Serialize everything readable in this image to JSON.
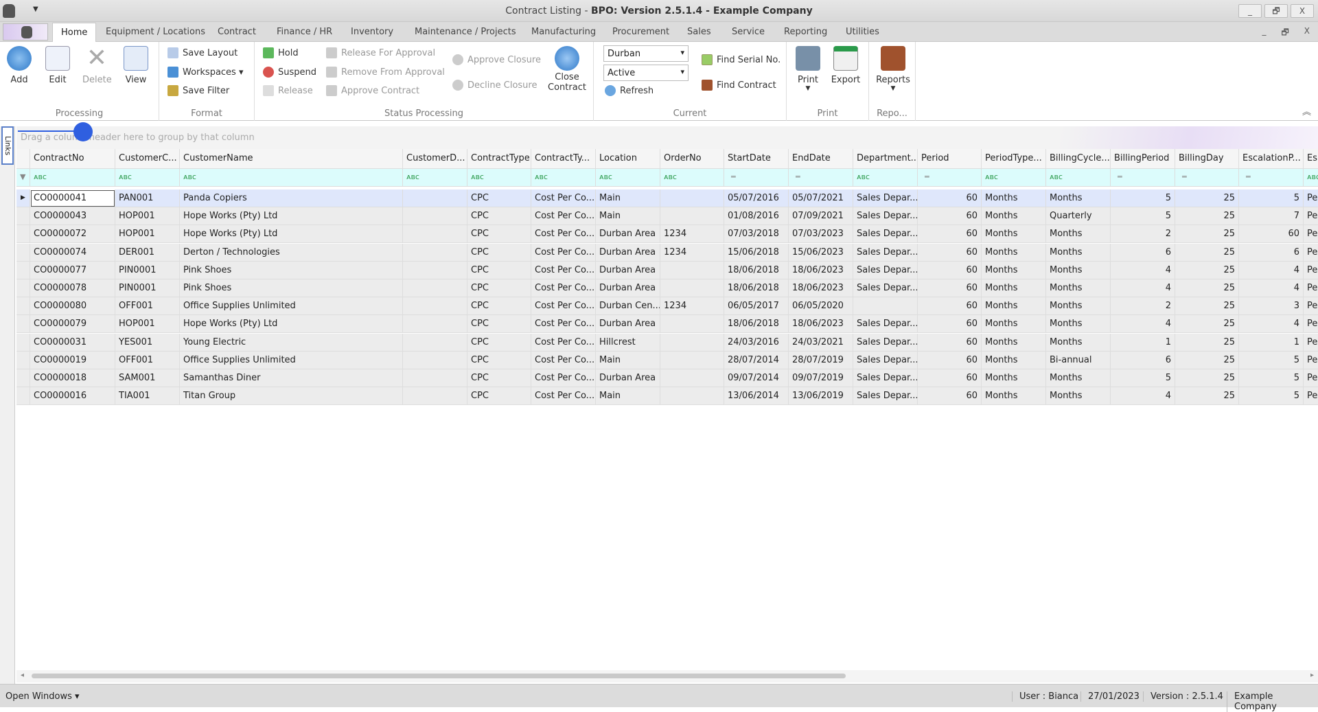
{
  "window": {
    "title_prefix": "Contract Listing - ",
    "title_bold": "BPO: Version 2.5.1.4 - Example Company",
    "min": "_",
    "restore": "🗗",
    "close": "X"
  },
  "tabs": [
    "Home",
    "Equipment / Locations",
    "Contract",
    "Finance / HR",
    "Inventory",
    "Maintenance / Projects",
    "Manufacturing",
    "Procurement",
    "Sales",
    "Service",
    "Reporting",
    "Utilities"
  ],
  "ribbon": {
    "processing": {
      "label": "Processing",
      "add": "Add",
      "edit": "Edit",
      "delete": "Delete",
      "view": "View"
    },
    "format": {
      "label": "Format",
      "save_layout": "Save Layout",
      "workspaces": "Workspaces ▾",
      "save_filter": "Save Filter"
    },
    "status": {
      "label": "Status Processing",
      "hold": "Hold",
      "suspend": "Suspend",
      "release": "Release",
      "release_for_approval": "Release For Approval",
      "remove_from_approval": "Remove From Approval",
      "approve_contract": "Approve Contract",
      "approve_closure": "Approve Closure",
      "decline_closure": "Decline Closure",
      "close_contract_1": "Close",
      "close_contract_2": "Contract"
    },
    "current": {
      "label": "Current",
      "branch": "Durban",
      "state": "Active",
      "refresh": "Refresh",
      "find_serial": "Find Serial No.",
      "find_contract": "Find Contract"
    },
    "print": {
      "label": "Print",
      "print": "Print",
      "export": "Export"
    },
    "reports": {
      "label": "Repo...",
      "reports": "Reports"
    }
  },
  "links_label": "Links",
  "group_hint": "Drag a column header here to group by that column",
  "columns": [
    "ContractNo",
    "CustomerC...",
    "CustomerName",
    "CustomerD...",
    "ContractType",
    "ContractTy...",
    "Location",
    "OrderNo",
    "StartDate",
    "EndDate",
    "Department...",
    "Period",
    "PeriodType...",
    "BillingCycle...",
    "BillingPeriod",
    "BillingDay",
    "EscalationP...",
    "Es"
  ],
  "filter_icons": [
    "abc",
    "abc",
    "abc",
    "abc",
    "abc",
    "abc",
    "abc",
    "abc",
    "=",
    "=",
    "abc",
    "=",
    "abc",
    "abc",
    "=",
    "=",
    "=",
    "abc"
  ],
  "rows": [
    [
      "CO0000041",
      "PAN001",
      "Panda Copiers",
      "",
      "CPC",
      "Cost Per Co...",
      "Main",
      "",
      "05/07/2016",
      "05/07/2021",
      "Sales Depar...",
      "60",
      "Months",
      "Months",
      "5",
      "25",
      "5",
      "Pe"
    ],
    [
      "CO0000043",
      "HOP001",
      "Hope Works (Pty) Ltd",
      "",
      "CPC",
      "Cost Per Co...",
      "Main",
      "",
      "01/08/2016",
      "07/09/2021",
      "Sales Depar...",
      "60",
      "Months",
      "Quarterly",
      "5",
      "25",
      "7",
      "Pe"
    ],
    [
      "CO0000072",
      "HOP001",
      "Hope Works (Pty) Ltd",
      "",
      "CPC",
      "Cost Per Co...",
      "Durban Area",
      "1234",
      "07/03/2018",
      "07/03/2023",
      "Sales Depar...",
      "60",
      "Months",
      "Months",
      "2",
      "25",
      "60",
      "Pe"
    ],
    [
      "CO0000074",
      "DER001",
      "Derton / Technologies",
      "",
      "CPC",
      "Cost Per Co...",
      "Durban Area",
      "1234",
      "15/06/2018",
      "15/06/2023",
      "Sales Depar...",
      "60",
      "Months",
      "Months",
      "6",
      "25",
      "6",
      "Pe"
    ],
    [
      "CO0000077",
      "PIN0001",
      "Pink Shoes",
      "",
      "CPC",
      "Cost Per Co...",
      "Durban Area",
      "",
      "18/06/2018",
      "18/06/2023",
      "Sales Depar...",
      "60",
      "Months",
      "Months",
      "4",
      "25",
      "4",
      "Pe"
    ],
    [
      "CO0000078",
      "PIN0001",
      "Pink Shoes",
      "",
      "CPC",
      "Cost Per Co...",
      "Durban Area",
      "",
      "18/06/2018",
      "18/06/2023",
      "Sales Depar...",
      "60",
      "Months",
      "Months",
      "4",
      "25",
      "4",
      "Pe"
    ],
    [
      "CO0000080",
      "OFF001",
      "Office Supplies Unlimited",
      "",
      "CPC",
      "Cost Per Co...",
      "Durban Cen...",
      "1234",
      "06/05/2017",
      "06/05/2020",
      "",
      "60",
      "Months",
      "Months",
      "2",
      "25",
      "3",
      "Pe"
    ],
    [
      "CO0000079",
      "HOP001",
      "Hope Works (Pty) Ltd",
      "",
      "CPC",
      "Cost Per Co...",
      "Durban Area",
      "",
      "18/06/2018",
      "18/06/2023",
      "Sales Depar...",
      "60",
      "Months",
      "Months",
      "4",
      "25",
      "4",
      "Pe"
    ],
    [
      "CO0000031",
      "YES001",
      "Young Electric",
      "",
      "CPC",
      "Cost Per Co...",
      "Hillcrest",
      "",
      "24/03/2016",
      "24/03/2021",
      "Sales Depar...",
      "60",
      "Months",
      "Months",
      "1",
      "25",
      "1",
      "Pe"
    ],
    [
      "CO0000019",
      "OFF001",
      "Office Supplies Unlimited",
      "",
      "CPC",
      "Cost Per Co...",
      "Main",
      "",
      "28/07/2014",
      "28/07/2019",
      "Sales Depar...",
      "60",
      "Months",
      "Bi-annual",
      "6",
      "25",
      "5",
      "Pe"
    ],
    [
      "CO0000018",
      "SAM001",
      "Samanthas Diner",
      "",
      "CPC",
      "Cost Per Co...",
      "Durban Area",
      "",
      "09/07/2014",
      "09/07/2019",
      "Sales Depar...",
      "60",
      "Months",
      "Months",
      "5",
      "25",
      "5",
      "Pe"
    ],
    [
      "CO0000016",
      "TIA001",
      "Titan Group",
      "",
      "CPC",
      "Cost Per Co...",
      "Main",
      "",
      "13/06/2014",
      "13/06/2019",
      "Sales Depar...",
      "60",
      "Months",
      "Months",
      "4",
      "25",
      "5",
      "Pe"
    ]
  ],
  "status": {
    "open_windows": "Open Windows ▾",
    "user": "User : Bianca",
    "date": "27/01/2023",
    "version": "Version : 2.5.1.4",
    "company": "Example Company"
  }
}
